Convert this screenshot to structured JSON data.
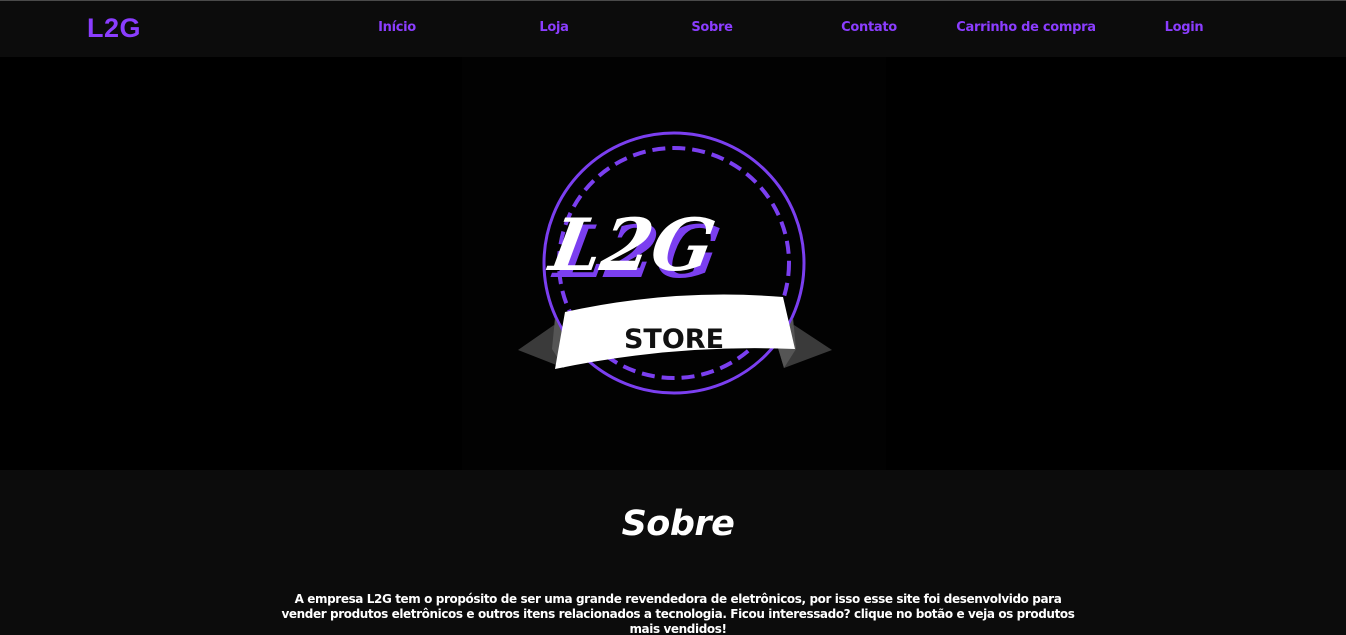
{
  "navbar": {
    "brand": "L2G",
    "links": [
      "Início",
      "Loja",
      "Sobre",
      "Contato",
      "Carrinho de compra",
      "Login"
    ]
  },
  "hero": {
    "logo": {
      "wordmark": "L2G",
      "banner_text": "STORE"
    }
  },
  "about": {
    "title": "Sobre",
    "text": "A empresa L2G tem o propósito de ser uma grande revendedora de eletrônicos, por isso esse site foi desenvolvido para vender produtos eletrônicos e outros itens relacionados a tecnologia. Ficou interessado? clique no botão e veja os produtos mais vendidos!"
  },
  "colors": {
    "accent": "#8b3dff",
    "background": "#0c0c0c",
    "hero_background": "#000000",
    "text": "#ffffff"
  }
}
